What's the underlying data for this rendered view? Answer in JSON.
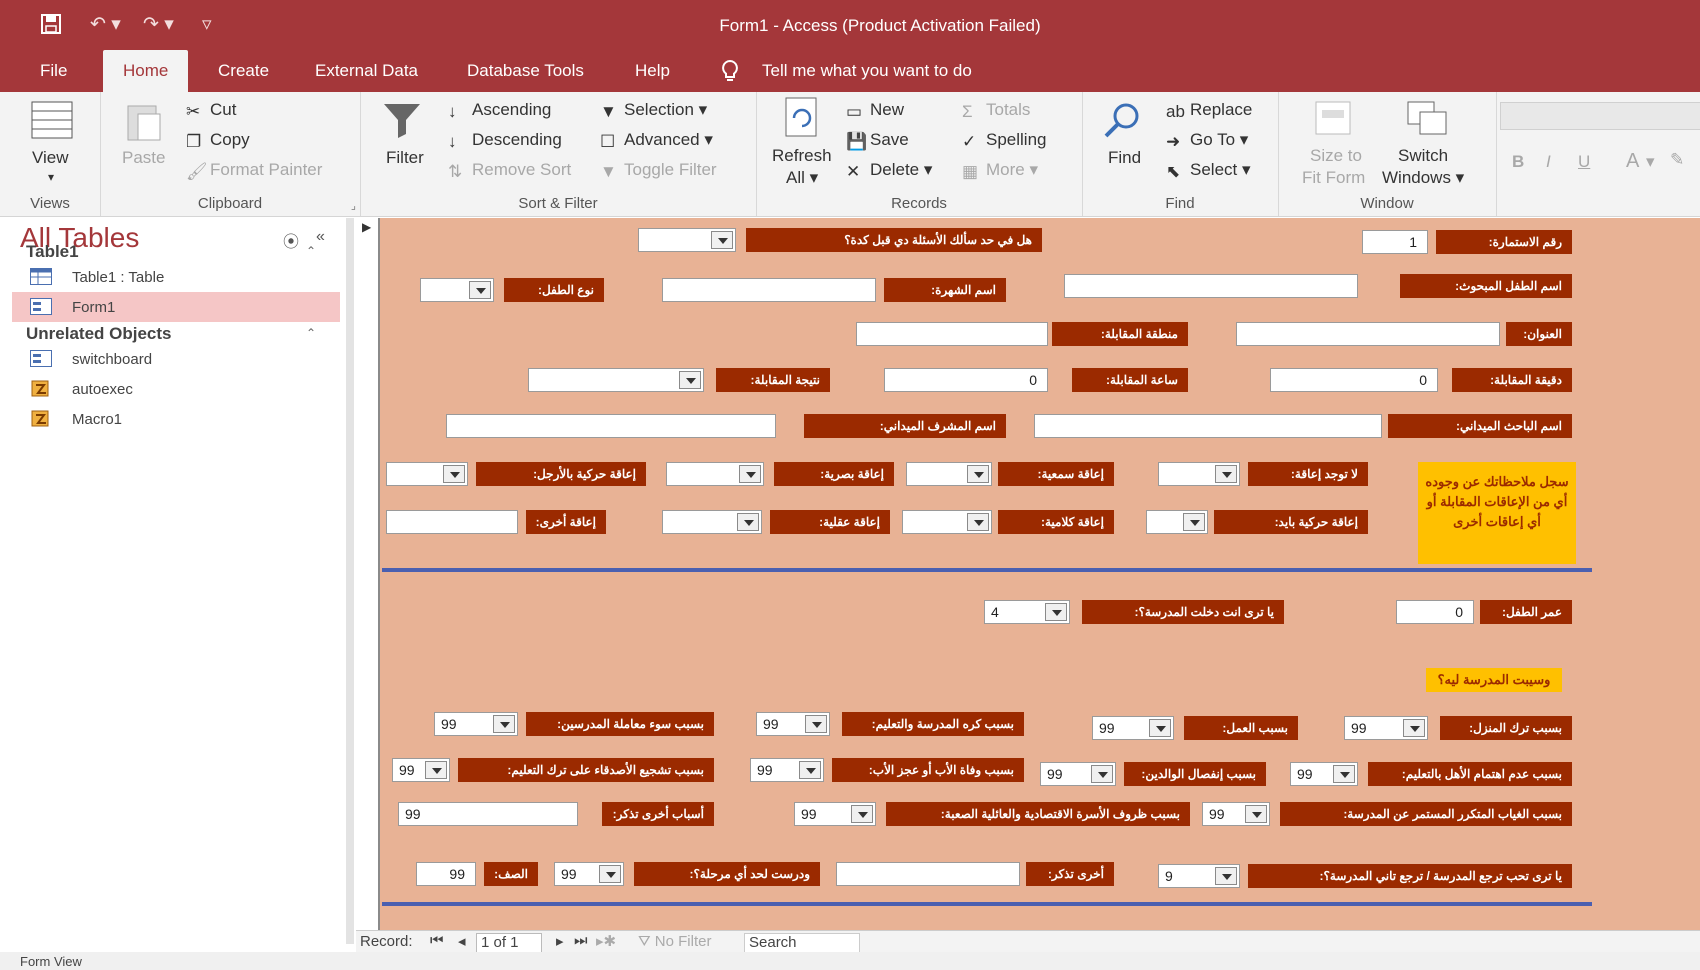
{
  "window": {
    "title": "Form1  -  Access (Product Activation Failed)"
  },
  "tabs": [
    "File",
    "Home",
    "Create",
    "External Data",
    "Database Tools",
    "Help"
  ],
  "tell_me": "Tell me what you want to do",
  "ribbon": {
    "views": {
      "view": "View",
      "group": "Views"
    },
    "clipboard": {
      "paste": "Paste",
      "cut": "Cut",
      "copy": "Copy",
      "format_painter": "Format Painter",
      "group": "Clipboard"
    },
    "sort_filter": {
      "filter": "Filter",
      "ascending": "Ascending",
      "descending": "Descending",
      "remove_sort": "Remove Sort",
      "selection": "Selection ▾",
      "advanced": "Advanced ▾",
      "toggle_filter": "Toggle Filter",
      "group": "Sort & Filter"
    },
    "records": {
      "refresh": "Refresh",
      "refresh_all": "All ▾",
      "new": "New",
      "save": "Save",
      "delete": "Delete",
      "totals": "Totals",
      "spelling": "Spelling",
      "more": "More ▾",
      "group": "Records"
    },
    "find": {
      "find": "Find",
      "replace": "Replace",
      "goto": "Go To ▾",
      "select": "Select ▾",
      "group": "Find"
    },
    "window": {
      "size_to": "Size to",
      "fit_form": "Fit Form",
      "switch": "Switch",
      "windows": "Windows ▾",
      "group": "Window"
    },
    "text": {
      "bold": "B",
      "italic": "I",
      "underline": "U",
      "font_color": "A"
    }
  },
  "nav": {
    "title": "All Tables",
    "group1": "Table1",
    "group1_items": [
      "Table1 : Table",
      "Form1"
    ],
    "group2": "Unrelated Objects",
    "group2_items": [
      "switchboard",
      "autoexec",
      "Macro1"
    ]
  },
  "form": {
    "labels": {
      "q_before": "هل في حد سألك الأسئلة دي قبل كدة؟",
      "form_no": "رقم الاستمارة:",
      "child_name": "اسم الطفل المبحوث:",
      "fame_name": "اسم الشهرة:",
      "child_type": "نوع الطفل:",
      "address": "العنوان:",
      "interview_area": "منطقة المقابلة:",
      "minute": "دقيقة المقابلة:",
      "hour": "ساعة المقابلة:",
      "result": "نتيجة المقابلة:",
      "researcher": "اسم الباحث الميداني:",
      "supervisor": "اسم المشرف الميداني:",
      "no_disability": "لا توجد إعاقة:",
      "hearing": "إعاقة سمعية:",
      "visual": "إعاقة بصرية:",
      "motor_legs": "إعاقة حركية بالأرجل:",
      "motor_hands": "إعاقة حركية بايد:",
      "speech": "إعاقة كلامية:",
      "mental": "إعاقة عقلية:",
      "other_dis": "إعاقة أخرى:",
      "yellow_note": "سجل ملاحظاتك عن وجوده أي من الإعاقات المقابلة أو أي إعاقات أخرى",
      "age": "عمر الطفل:",
      "ever_school": "يا ترى انت دخلت المدرسة؟:",
      "why_left": "وسيبت المدرسة ليه؟",
      "reason_home": "بسبب ترك المنزل:",
      "reason_work": "بسبب العمل:",
      "reason_hate": "بسبب كره المدرسة والتعليم:",
      "reason_teachers": "بسبب سوء معاملة المدرسين:",
      "reason_family_interest": "بسبب عدم اهتمام الأهل بالتعليم:",
      "reason_separation": "بسبب إنفصال الوالدين:",
      "reason_death": "بسبب وفاة الأب أو عجز الأب:",
      "reason_friends": "بسبب تشجيع الأصدقاء على ترك التعليم:",
      "reason_absence": "بسبب الغياب المتكرر المستمر عن المدرسة:",
      "reason_economic": "بسبب ظروف الأسرة الاقتصادية والعائلية الصعبة:",
      "other_reasons": "أسباب أخرى تذكر:",
      "return_school": "يا ترى تحب ترجع المدرسة / ترجع تاني المدرسة؟:",
      "other_mention": "أخرى تذكر:",
      "stage": "ودرست لحد أي مرحلة؟:",
      "grade": "الصف:"
    },
    "values": {
      "form_no": "1",
      "minute": "0",
      "hour": "0",
      "age": "0",
      "ever_school": "4",
      "r99": "99",
      "return_school": "9"
    }
  },
  "record_nav": {
    "record": "Record:",
    "position": "1 of 1",
    "no_filter": "No Filter",
    "search": "Search"
  },
  "status": "Form View"
}
